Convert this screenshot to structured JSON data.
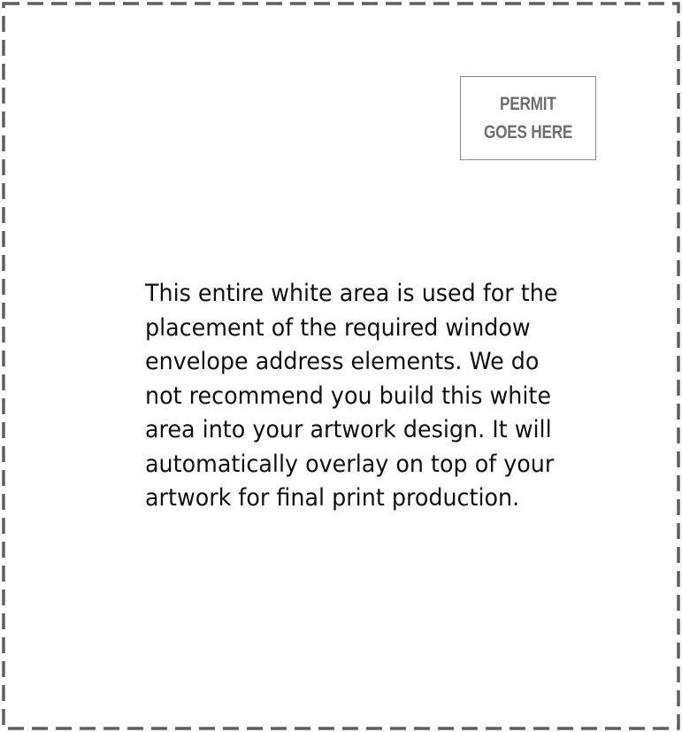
{
  "permit": {
    "line1": "PERMIT",
    "line2": "GOES HERE"
  },
  "notice": {
    "lines": [
      "This entire white area is used for the",
      "placement of the required window",
      "envelope address elements. We do",
      "not recommend you build this white",
      "area into your artwork design. It will",
      "automatically overlay on top of your",
      "artwork for final print production."
    ]
  },
  "colors": {
    "border": "#5f5f5f",
    "permit_border": "#8a8a8a",
    "permit_text": "#6e6e6e",
    "text": "#111111",
    "background": "#ffffff"
  }
}
